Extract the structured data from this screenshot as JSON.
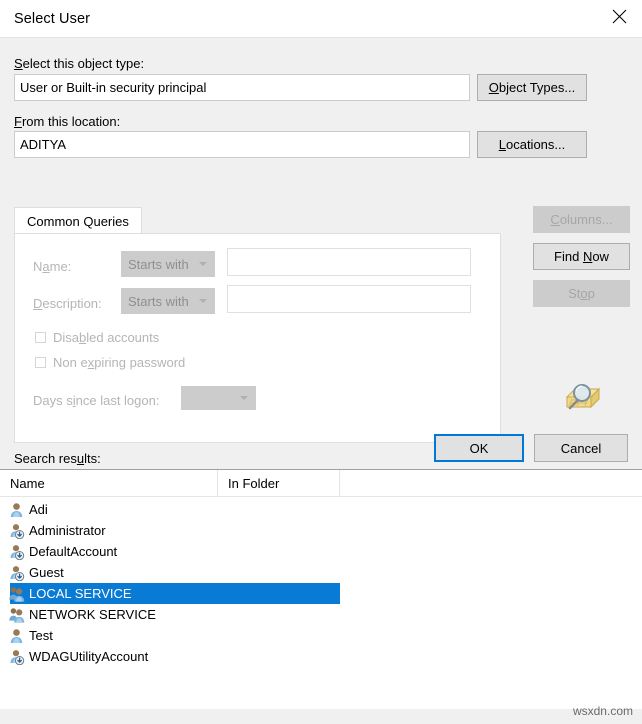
{
  "window": {
    "title": "Select User",
    "close_icon": "close-icon"
  },
  "form": {
    "object_type_label": "Select this object type:",
    "object_type_value": "User or Built-in security principal",
    "object_types_button": "Object Types...",
    "location_label": "From this location:",
    "location_value": "ADITYA",
    "locations_button": "Locations..."
  },
  "tabs": {
    "items": [
      {
        "label": "Common Queries",
        "active": true
      }
    ]
  },
  "query": {
    "name_label": "Name:",
    "name_operator": "Starts with",
    "name_value": "",
    "description_label": "Description:",
    "description_operator": "Starts with",
    "description_value": "",
    "disabled_accounts_label": "Disabled accounts",
    "disabled_accounts_checked": false,
    "non_expiring_password_label": "Non expiring password",
    "non_expiring_password_checked": false,
    "days_since_last_logon_label": "Days since last logon:",
    "days_since_last_logon_value": ""
  },
  "side_buttons": {
    "columns": "Columns...",
    "find_now": "Find Now",
    "stop": "Stop",
    "search_icon": "magnifier-folder-icon"
  },
  "dialog_buttons": {
    "ok": "OK",
    "cancel": "Cancel"
  },
  "results": {
    "label": "Search results:",
    "columns": [
      "Name",
      "In Folder"
    ],
    "rows": [
      {
        "name": "Adi",
        "in_folder": "",
        "icon": "user-icon",
        "selected": false
      },
      {
        "name": "Administrator",
        "in_folder": "",
        "icon": "user-disabled-icon",
        "selected": false
      },
      {
        "name": "DefaultAccount",
        "in_folder": "",
        "icon": "user-disabled-icon",
        "selected": false
      },
      {
        "name": "Guest",
        "in_folder": "",
        "icon": "user-disabled-icon",
        "selected": false
      },
      {
        "name": "LOCAL SERVICE",
        "in_folder": "",
        "icon": "group-icon",
        "selected": true
      },
      {
        "name": "NETWORK SERVICE",
        "in_folder": "",
        "icon": "group-icon",
        "selected": false
      },
      {
        "name": "Test",
        "in_folder": "",
        "icon": "user-icon",
        "selected": false
      },
      {
        "name": "WDAGUtilityAccount",
        "in_folder": "",
        "icon": "user-disabled-icon",
        "selected": false
      }
    ]
  },
  "watermark": "wsxdn.com",
  "colors": {
    "selection": "#0a7bd4",
    "focus": "#0078d7",
    "dialog_bg": "#f0f0f0"
  }
}
